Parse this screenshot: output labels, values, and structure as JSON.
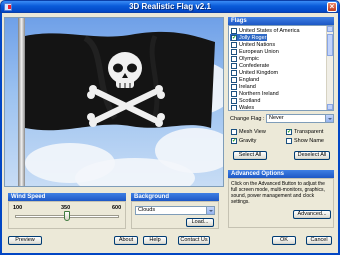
{
  "window": {
    "title": "3D Realistic Flag v2.1"
  },
  "flag_list": {
    "header": "Flags",
    "items": [
      {
        "label": "United States of America",
        "checked": false,
        "selected": false
      },
      {
        "label": "Jolly Roger",
        "checked": true,
        "selected": true
      },
      {
        "label": "United Nations",
        "checked": false,
        "selected": false
      },
      {
        "label": "European Union",
        "checked": false,
        "selected": false
      },
      {
        "label": "Olympic",
        "checked": false,
        "selected": false
      },
      {
        "label": "Confederate",
        "checked": false,
        "selected": false
      },
      {
        "label": "United Kingdom",
        "checked": false,
        "selected": false
      },
      {
        "label": "England",
        "checked": false,
        "selected": false
      },
      {
        "label": "Ireland",
        "checked": false,
        "selected": false
      },
      {
        "label": "Northern Ireland",
        "checked": false,
        "selected": false
      },
      {
        "label": "Scotland",
        "checked": false,
        "selected": false
      },
      {
        "label": "Wales",
        "checked": false,
        "selected": false
      }
    ]
  },
  "change_flag": {
    "label": "Change Flag :",
    "value": "Never"
  },
  "options": {
    "mesh_view": {
      "label": "Mesh View",
      "checked": false
    },
    "transparent": {
      "label": "Transparent",
      "checked": true
    },
    "gravity": {
      "label": "Gravity",
      "checked": true
    },
    "show_name": {
      "label": "Show Name",
      "checked": false
    }
  },
  "buttons": {
    "select_all": "Select All",
    "deselect_all": "Deselect All",
    "advanced": "Advanced...",
    "load": "Load...",
    "preview": "Preview",
    "about": "About",
    "help": "Help",
    "contact_us": "Contact Us",
    "ok": "OK",
    "cancel": "Cancel"
  },
  "advanced_options": {
    "header": "Advanced Options",
    "text": "Click on the Advanced Button to adjust the full screen mode, multi-monitors, graphics, sound, power management and clock settings."
  },
  "wind_speed": {
    "header": "Wind Speed",
    "min": "100",
    "mid": "350",
    "max": "600",
    "value_fraction": 0.5
  },
  "background": {
    "header": "Background",
    "value": "Clouds"
  },
  "colors": {
    "accent": "#0a5bd9",
    "group_header": "#2a67d2",
    "selection": "#316ac5"
  }
}
